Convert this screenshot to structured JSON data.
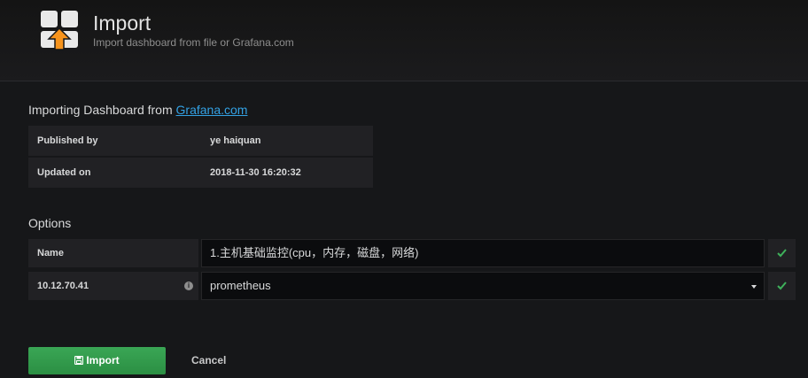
{
  "header": {
    "icon": "dashboard-import-icon",
    "title": "Import",
    "subtitle": "Import dashboard from file or Grafana.com"
  },
  "importing": {
    "heading_prefix": "Importing Dashboard from ",
    "heading_link": "Grafana.com",
    "rows": [
      {
        "label": "Published by",
        "value": "ye haiquan"
      },
      {
        "label": "Updated on",
        "value": "2018-11-30 16:20:32"
      }
    ]
  },
  "options": {
    "heading": "Options",
    "name_label": "Name",
    "name_value": "1.主机基础监控(cpu，内存，磁盘，网络)",
    "datasource_label": "10.12.70.41",
    "datasource_value": "prometheus",
    "info_icon": "info-icon",
    "check_icon": "check-icon"
  },
  "actions": {
    "import_label": "Import",
    "import_icon": "save-icon",
    "cancel_label": "Cancel"
  },
  "colors": {
    "link": "#33a2e5",
    "success": "#299c46",
    "check": "#3eb15b"
  }
}
